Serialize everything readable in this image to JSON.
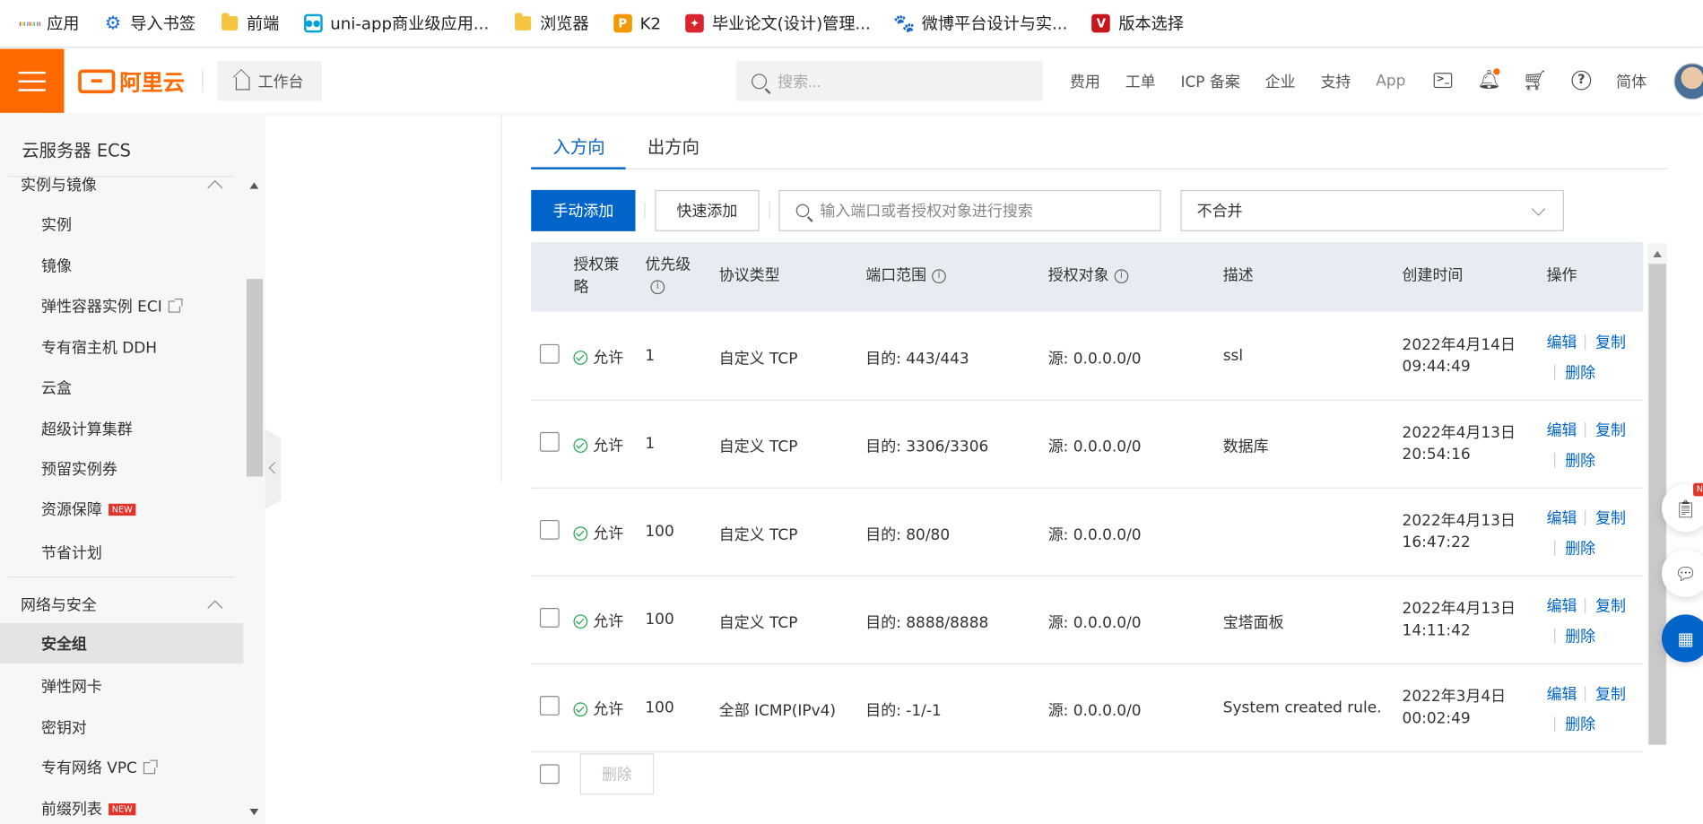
{
  "bookmarks": [
    {
      "label": "应用",
      "icon": "apps-grid-icon"
    },
    {
      "label": "导入书签",
      "icon": "gear-icon"
    },
    {
      "label": "前端",
      "icon": "folder-icon"
    },
    {
      "label": "uni-app商业级应用...",
      "icon": "tv-icon"
    },
    {
      "label": "浏览器",
      "icon": "folder-icon"
    },
    {
      "label": "K2",
      "icon": "p-logo-icon"
    },
    {
      "label": "毕业论文(设计)管理...",
      "icon": "school-logo-icon"
    },
    {
      "label": "微博平台设计与实...",
      "icon": "paw-icon"
    },
    {
      "label": "版本选择",
      "icon": "v-logo-icon"
    }
  ],
  "header": {
    "logo_text": "阿里云",
    "workbench": "工作台",
    "search_placeholder": "搜索...",
    "links": [
      "费用",
      "工单",
      "ICP 备案",
      "企业",
      "支持",
      "App"
    ],
    "lang": "简体"
  },
  "sidebar": {
    "title": "云服务器 ECS",
    "groups": [
      {
        "label": "实例与镜像",
        "items": [
          {
            "label": "实例"
          },
          {
            "label": "镜像"
          },
          {
            "label": "弹性容器实例 ECI",
            "external": true
          },
          {
            "label": "专有宿主机 DDH"
          },
          {
            "label": "云盒"
          },
          {
            "label": "超级计算集群"
          },
          {
            "label": "预留实例券"
          },
          {
            "label": "资源保障",
            "badge": "NEW"
          },
          {
            "label": "节省计划"
          }
        ]
      },
      {
        "label": "网络与安全",
        "items": [
          {
            "label": "安全组",
            "active": true
          },
          {
            "label": "弹性网卡"
          },
          {
            "label": "密钥对"
          },
          {
            "label": "专有网络 VPC",
            "external": true
          },
          {
            "label": "前缀列表",
            "badge": "NEW"
          }
        ]
      }
    ]
  },
  "tabs": [
    "入方向",
    "出方向"
  ],
  "toolbar": {
    "add_manual": "手动添加",
    "add_quick": "快速添加",
    "search_placeholder": "输入端口或者授权对象进行搜索",
    "merge_select": "不合并"
  },
  "table": {
    "headers": [
      "授权策略",
      "优先级",
      "协议类型",
      "端口范围",
      "授权对象",
      "描述",
      "创建时间",
      "操作"
    ],
    "rows": [
      {
        "policy": "允许",
        "priority": "1",
        "protocol": "自定义 TCP",
        "port": "目的: 443/443",
        "source": "源: 0.0.0.0/0",
        "desc": "ssl",
        "date": "2022年4月14日",
        "time": "09:44:49"
      },
      {
        "policy": "允许",
        "priority": "1",
        "protocol": "自定义 TCP",
        "port": "目的: 3306/3306",
        "source": "源: 0.0.0.0/0",
        "desc": "数据库",
        "date": "2022年4月13日",
        "time": "20:54:16"
      },
      {
        "policy": "允许",
        "priority": "100",
        "protocol": "自定义 TCP",
        "port": "目的: 80/80",
        "source": "源: 0.0.0.0/0",
        "desc": "",
        "date": "2022年4月13日",
        "time": "16:47:22"
      },
      {
        "policy": "允许",
        "priority": "100",
        "protocol": "自定义 TCP",
        "port": "目的: 8888/8888",
        "source": "源: 0.0.0.0/0",
        "desc": "宝塔面板",
        "date": "2022年4月13日",
        "time": "14:11:42"
      },
      {
        "policy": "允许",
        "priority": "100",
        "protocol": "全部 ICMP(IPv4)",
        "port": "目的: -1/-1",
        "source": "源: 0.0.0.0/0",
        "desc": "System created rule.",
        "date": "2022年3月4日",
        "time": "00:02:49"
      }
    ],
    "actions": [
      "编辑",
      "复制",
      "删除"
    ],
    "bulk_delete": "删除"
  },
  "colors": {
    "brand": "#ff6a00",
    "primary": "#0064c8",
    "success": "#22a34a"
  },
  "float_badge": "N"
}
